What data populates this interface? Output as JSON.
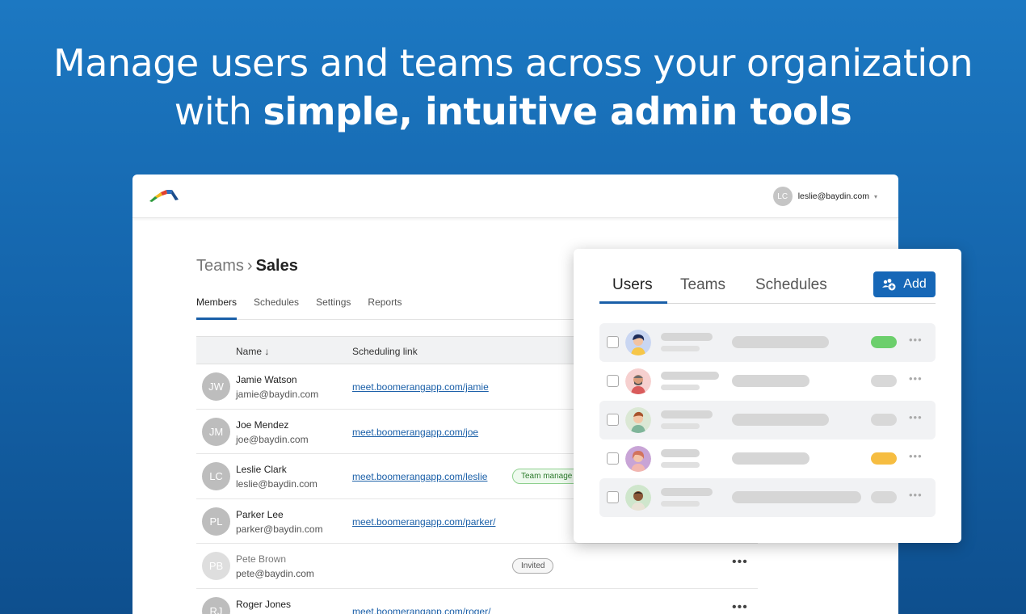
{
  "headline": {
    "line1": "Manage users and teams across your organization",
    "line2_regular": "with ",
    "line2_bold": "simple, intuitive admin tools"
  },
  "account": {
    "initials": "LC",
    "email": "leslie@baydin.com"
  },
  "breadcrumb": {
    "parent": "Teams",
    "separator": "›",
    "current": "Sales"
  },
  "tabs": [
    "Members",
    "Schedules",
    "Settings",
    "Reports"
  ],
  "table": {
    "headers": {
      "name": "Name",
      "link": "Scheduling link"
    },
    "rows": [
      {
        "initials": "JW",
        "name": "Jamie Watson",
        "email": "jamie@baydin.com",
        "link": "meet.boomerangapp.com/jamie",
        "badge": ""
      },
      {
        "initials": "JM",
        "name": "Joe Mendez",
        "email": "joe@baydin.com",
        "link": "meet.boomerangapp.com/joe",
        "badge": ""
      },
      {
        "initials": "LC",
        "name": "Leslie Clark",
        "email": "leslie@baydin.com",
        "link": "meet.boomerangapp.com/leslie",
        "badge": "Team manage"
      },
      {
        "initials": "PL",
        "name": "Parker Lee",
        "email": "parker@baydin.com",
        "link": "meet.boomerangapp.com/parker/",
        "badge": ""
      },
      {
        "initials": "PB",
        "name": "Pete Brown",
        "email": "pete@baydin.com",
        "link": "",
        "badge": "Invited"
      },
      {
        "initials": "RJ",
        "name": "Roger Jones",
        "email": "",
        "link": "meet.boomerangapp.com/roger/",
        "badge": ""
      }
    ]
  },
  "panel": {
    "tabs": [
      "Users",
      "Teams",
      "Schedules"
    ],
    "add_label": "Add",
    "status_colors": [
      "#6ccf6c",
      "#d8d8d8",
      "#d8d8d8",
      "#f6bd41",
      "#d8d8d8"
    ]
  }
}
